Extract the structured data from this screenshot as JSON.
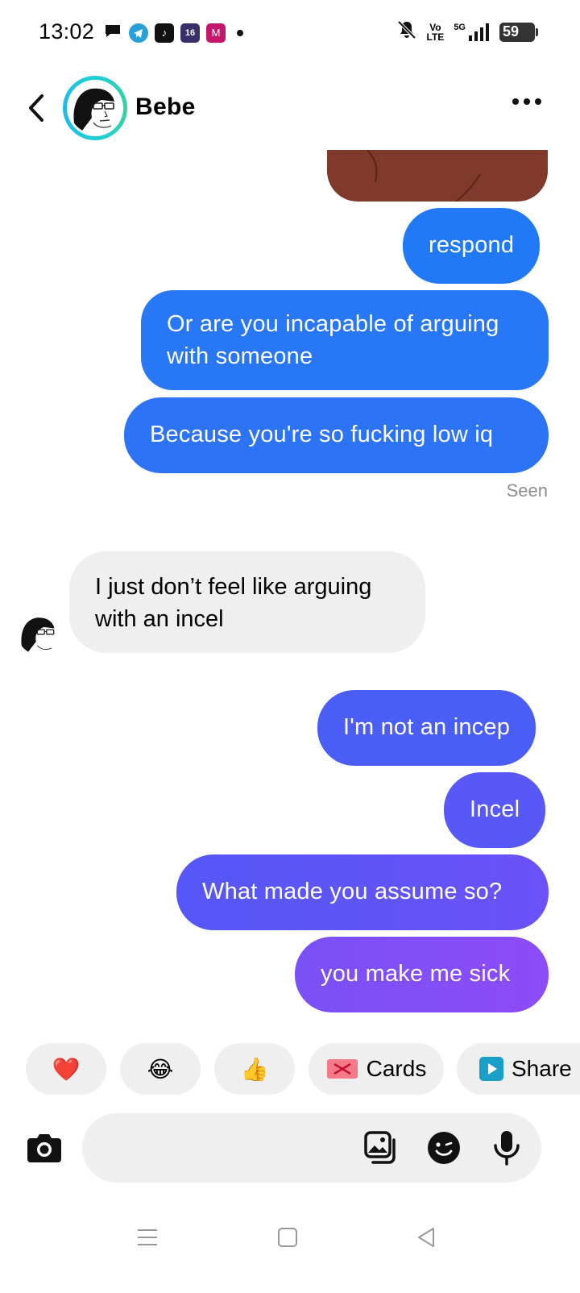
{
  "status_bar": {
    "time": "13:02",
    "volte_top": "Vo",
    "volte_bottom": "LTE",
    "network": "5G",
    "battery": "59"
  },
  "header": {
    "contact_name": "Bebe"
  },
  "messages": {
    "sent_1": "respond",
    "sent_2": "Or are you incapable of arguing with someone",
    "sent_3": "Because you're so fucking low iq",
    "seen": "Seen",
    "received_1": "I just don’t feel like arguing with an incel",
    "sent_4": "I'm not an incep",
    "sent_5": "Incel",
    "sent_6": "What made you assume so?",
    "sent_7": "you make me sick"
  },
  "quick_actions": {
    "heart": "❤️",
    "laugh": "😂",
    "thumbs": "👍",
    "cards_label": "Cards",
    "share_label": "Share"
  },
  "composer": {
    "placeholder": ""
  },
  "colors": {
    "bubble_blue_top": "#2478f6",
    "bubble_purple_bottom": "#8c4cf8",
    "received_bg": "#efefef",
    "media_brown": "#7f3a2b"
  },
  "icons": [
    "chat-icon",
    "telegram-icon",
    "tiktok-icon",
    "calendar-icon",
    "m-app-icon",
    "mute-icon",
    "signal-icon",
    "battery-icon",
    "back-icon",
    "more-icon",
    "camera-icon",
    "gallery-icon",
    "sticker-icon",
    "mic-icon",
    "menu-icon",
    "home-icon",
    "back-nav-icon"
  ]
}
